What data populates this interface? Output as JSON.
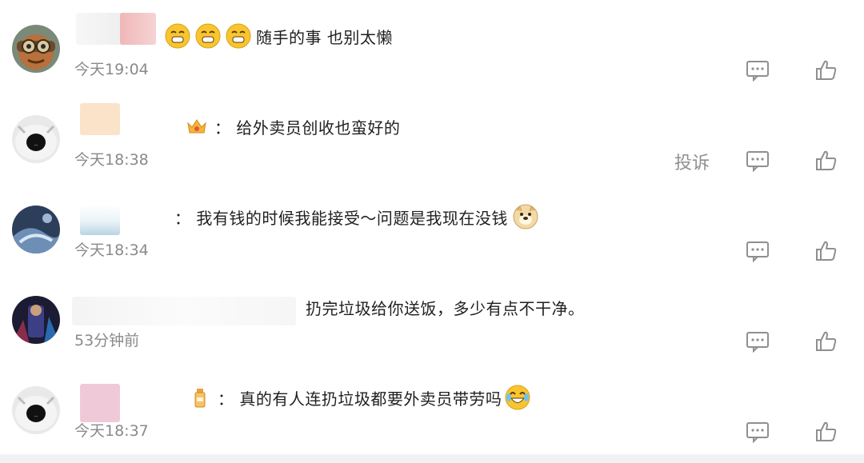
{
  "comments": [
    {
      "text": "随手的事 也别太懒",
      "time": "今天19:04",
      "emojis": [
        "grin-emoji",
        "grin-emoji",
        "grin-emoji"
      ],
      "badge": ""
    },
    {
      "text": "：  给外卖员创收也蛮好的",
      "time": "今天18:38",
      "emojis": [],
      "badge": "crown-badge",
      "report": "投诉"
    },
    {
      "text": "：  我有钱的时候我能接受～问题是我现在没钱",
      "time": "今天18:34",
      "emojis": [
        "doge-emoji"
      ],
      "badge": ""
    },
    {
      "text": "扔完垃圾给你送饭，多少有点不干净。",
      "time": "53分钟前",
      "emojis": [],
      "badge": ""
    },
    {
      "text": "：  真的有人连扔垃圾都要外卖员带劳吗",
      "time": "今天18:37",
      "emojis": [
        "laugh-cry-emoji"
      ],
      "badge": "bottle-badge"
    }
  ],
  "colors": {
    "text": "#1f1f1f",
    "time": "#8a8a8a",
    "icon": "#8f8f8f",
    "bottom_bar": "#f0f1f3"
  }
}
